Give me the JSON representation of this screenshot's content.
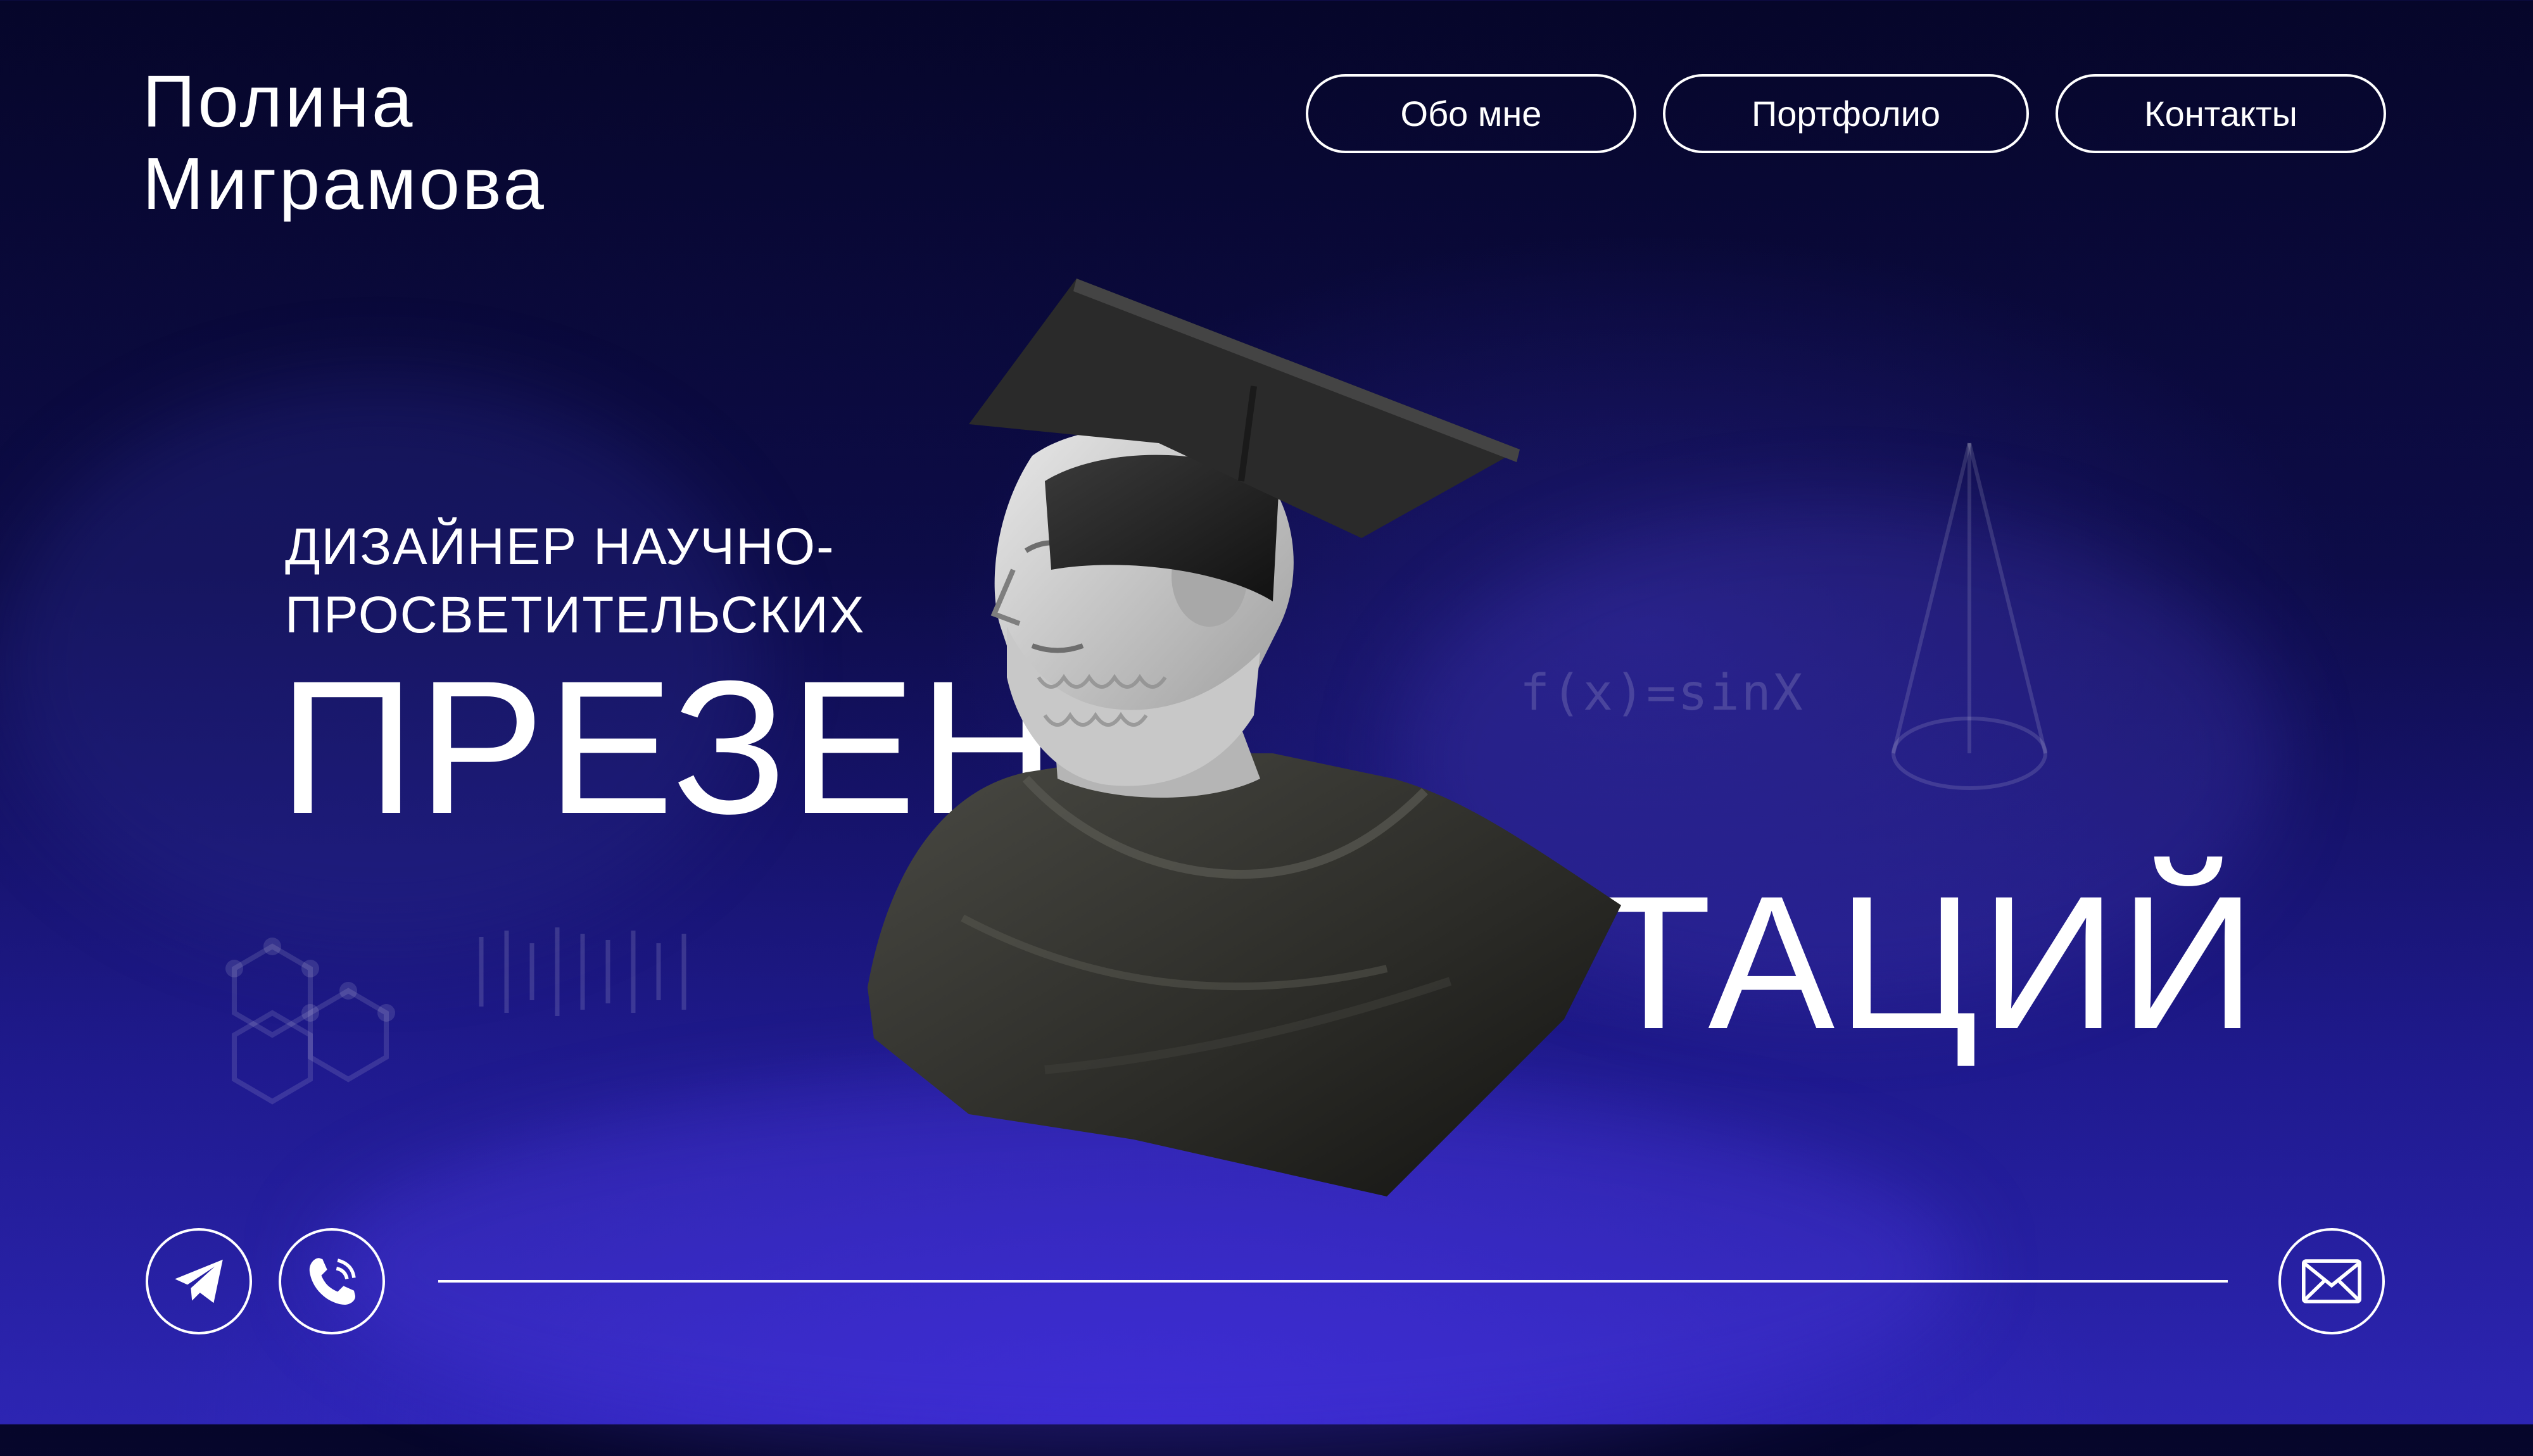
{
  "logo": {
    "line1": "Полина",
    "line2": "Миграмова"
  },
  "nav": {
    "about": "Обо мне",
    "portfolio": "Портфолио",
    "contacts": "Контакты"
  },
  "hero": {
    "subtitle": "ДИЗАЙНЕР НАУЧНО-ПРОСВЕТИТЕЛЬСКИХ",
    "headline_part1": "ПРЕЗЕН",
    "headline_part2": "ТАЦИЙ"
  },
  "decor": {
    "formula": "f(x)=sinX"
  },
  "footer": {
    "telegram_icon": "telegram-icon",
    "phone_icon": "phone-icon",
    "mail_icon": "mail-icon"
  },
  "colors": {
    "background_top": "#06062a",
    "background_bottom": "#2d25b3",
    "foreground": "#ffffff"
  }
}
